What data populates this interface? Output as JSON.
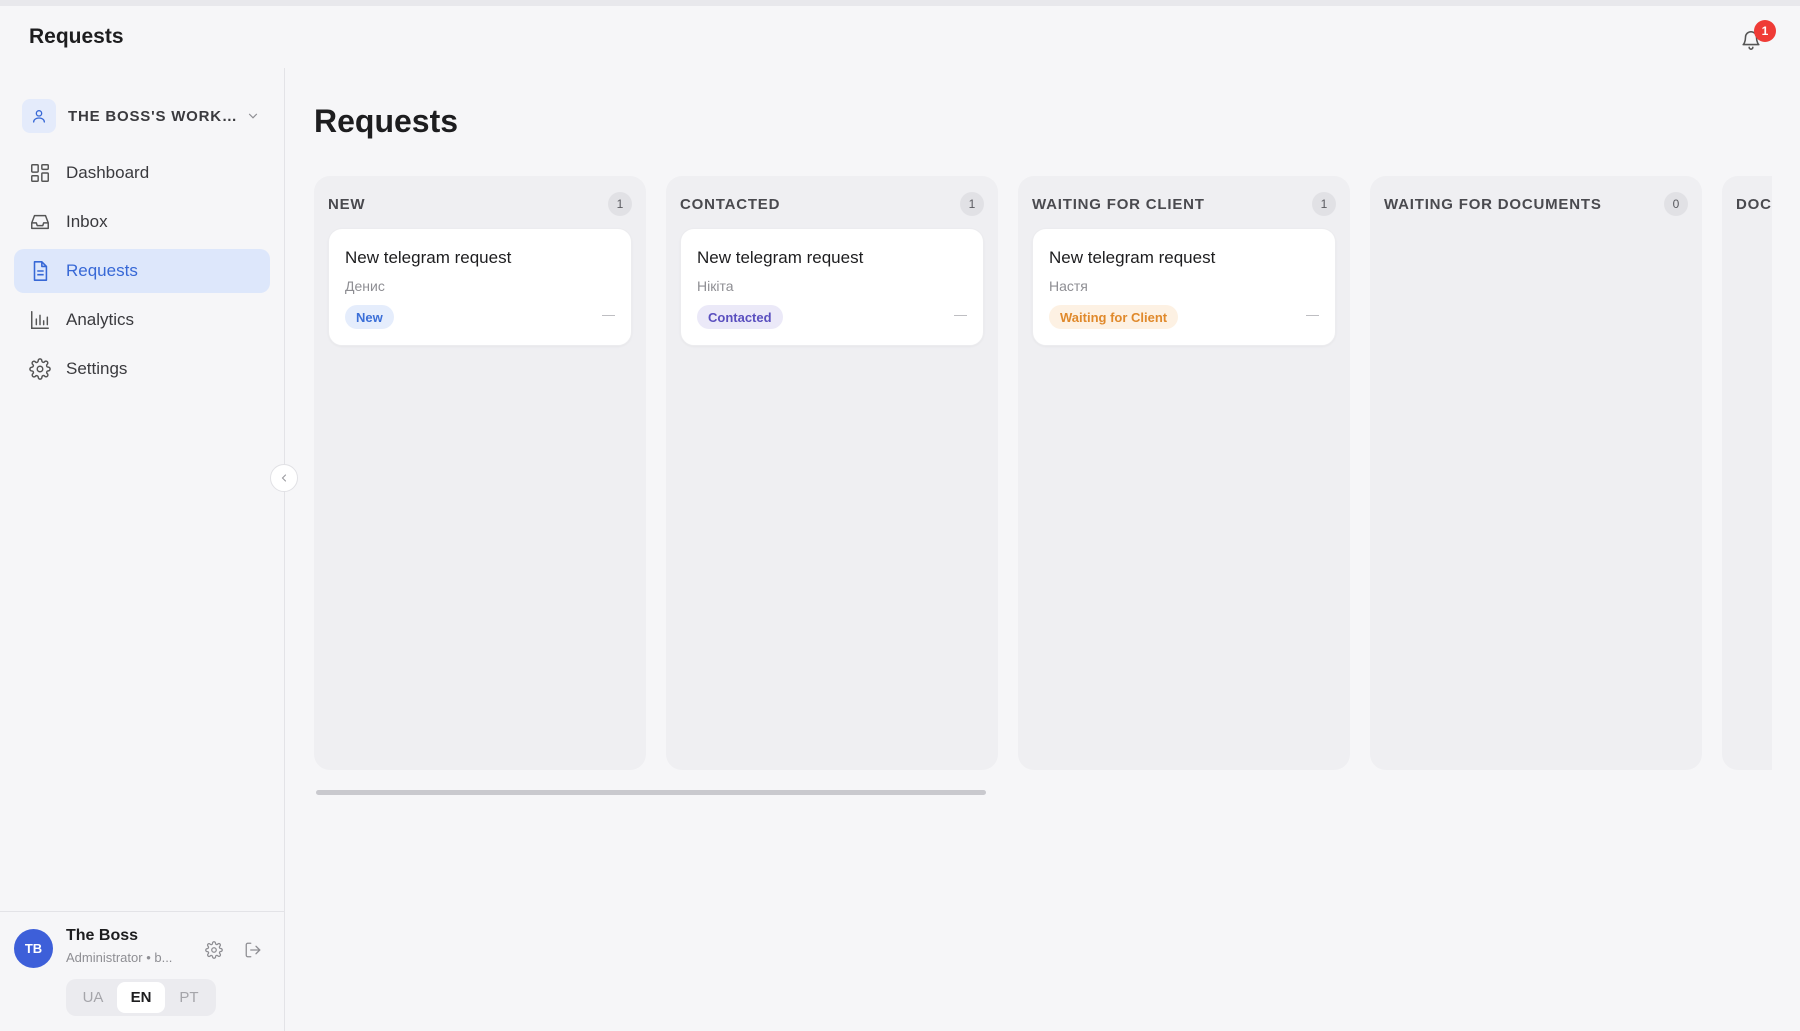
{
  "header": {
    "title": "Requests",
    "notifications_count": "1"
  },
  "sidebar": {
    "workspace_name": "THE BOSS'S WORKSPACE",
    "items": [
      {
        "label": "Dashboard",
        "icon": "dashboard-icon"
      },
      {
        "label": "Inbox",
        "icon": "inbox-icon"
      },
      {
        "label": "Requests",
        "icon": "document-icon",
        "active": true
      },
      {
        "label": "Analytics",
        "icon": "bar-chart-icon"
      },
      {
        "label": "Settings",
        "icon": "gear-icon"
      }
    ],
    "user": {
      "initials": "TB",
      "name": "The Boss",
      "role": "Administrator • b..."
    },
    "languages": [
      {
        "label": "UA",
        "active": false
      },
      {
        "label": "EN",
        "active": true
      },
      {
        "label": "PT",
        "active": false
      }
    ]
  },
  "main": {
    "title": "Requests",
    "columns": [
      {
        "title": "NEW",
        "count": "1",
        "cards": [
          {
            "title": "New telegram request",
            "client": "Денис",
            "status": "New",
            "status_color": "#3b6fd8",
            "status_bg": "#e5edfc",
            "meta": "—"
          }
        ]
      },
      {
        "title": "CONTACTED",
        "count": "1",
        "cards": [
          {
            "title": "New telegram request",
            "client": "Нікіта",
            "status": "Contacted",
            "status_color": "#5a4fbf",
            "status_bg": "#ebe9f8",
            "meta": "—"
          }
        ]
      },
      {
        "title": "WAITING FOR CLIENT",
        "count": "1",
        "cards": [
          {
            "title": "New telegram request",
            "client": "Настя",
            "status": "Waiting for Client",
            "status_color": "#e0892b",
            "status_bg": "#fdf1e3",
            "meta": "—"
          }
        ]
      },
      {
        "title": "WAITING FOR DOCUMENTS",
        "count": "0",
        "cards": []
      },
      {
        "title": "DOC",
        "count": "",
        "cards": []
      }
    ]
  },
  "colors": {
    "accent": "#3768d6",
    "active_nav_bg": "#dde7fb",
    "badge_red": "#ef3b36",
    "avatar_blue": "#3d5fd9"
  }
}
